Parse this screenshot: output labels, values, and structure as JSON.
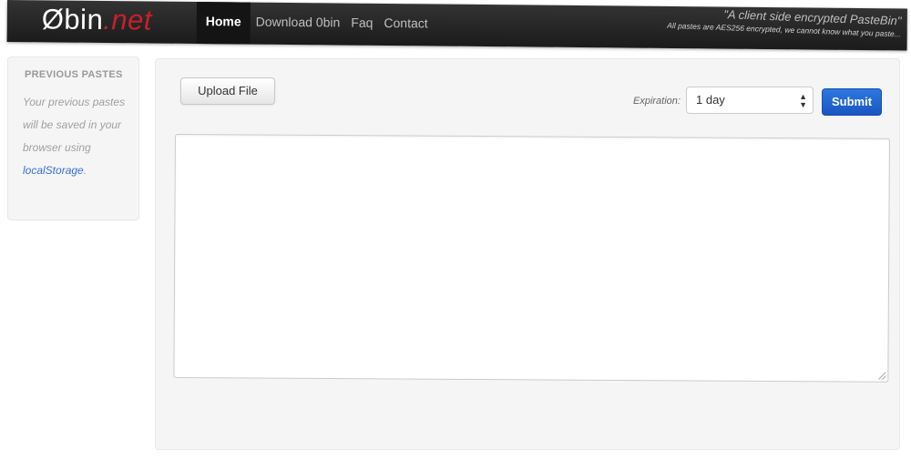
{
  "brand": {
    "name_main": "Øbin",
    "name_suffix": ".net"
  },
  "nav": {
    "items": [
      {
        "label": "Home",
        "active": true
      },
      {
        "label": "Download 0bin",
        "active": false
      },
      {
        "label": "Faq",
        "active": false
      },
      {
        "label": "Contact",
        "active": false
      }
    ]
  },
  "tagline": {
    "main": "\"A client side encrypted PasteBin\"",
    "sub": "All pastes are AES256 encrypted, we cannot know what you paste..."
  },
  "sidebar": {
    "title": "PREVIOUS PASTES",
    "text": "Your previous pastes will be saved in your browser using",
    "link": "localStorage",
    "text_end": "."
  },
  "form": {
    "upload_label": "Upload File",
    "expiration_label": "Expiration:",
    "expiration_value": "1 day",
    "submit_label": "Submit",
    "paste_content": ""
  },
  "colors": {
    "accent": "#1b55c2",
    "brand_red": "#c8202a",
    "navbar": "#222222"
  },
  "icons": {
    "select_arrows": "updown-arrows-icon",
    "resize": "resize-grip-icon"
  }
}
